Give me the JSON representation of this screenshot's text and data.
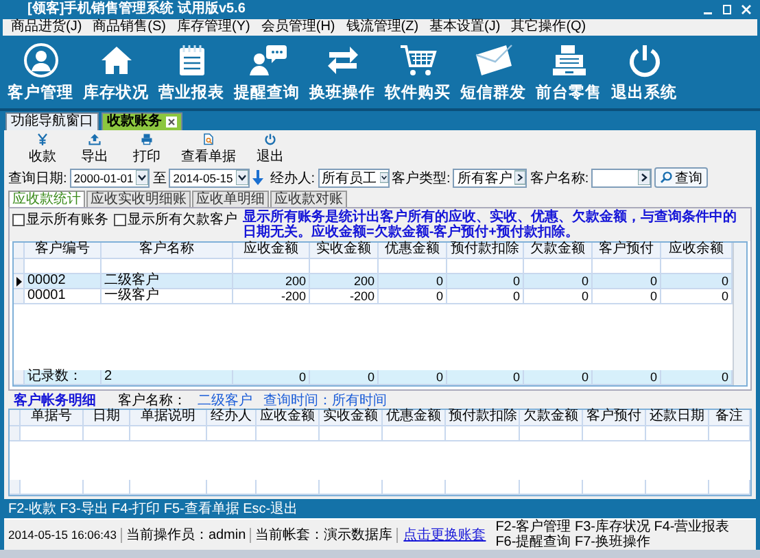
{
  "window": {
    "title": "[领客]手机销售管理系统 试用版v5.6"
  },
  "menu": [
    "商品进货(J)",
    "商品销售(S)",
    "库存管理(Y)",
    "会员管理(H)",
    "钱流管理(Z)",
    "基本设置(J)",
    "其它操作(Q)"
  ],
  "nav": [
    {
      "kind": "customer",
      "label": "客户管理"
    },
    {
      "kind": "house",
      "label": "库存状况"
    },
    {
      "kind": "report",
      "label": "营业报表"
    },
    {
      "kind": "chat",
      "label": "提醒查询"
    },
    {
      "kind": "swap",
      "label": "换班操作"
    },
    {
      "kind": "cart",
      "label": "软件购买"
    },
    {
      "kind": "mail",
      "label": "短信群发"
    },
    {
      "kind": "register",
      "label": "前台零售"
    },
    {
      "kind": "power",
      "label": "退出系统"
    }
  ],
  "tabs": [
    {
      "label": "功能导航窗口",
      "selected": false,
      "closable": false
    },
    {
      "label": "收款账务",
      "selected": true,
      "closable": true
    }
  ],
  "toolbar": [
    {
      "kind": "yen",
      "label": "收款"
    },
    {
      "kind": "export",
      "label": "导出"
    },
    {
      "kind": "print",
      "label": "打印"
    },
    {
      "kind": "doc",
      "label": "查看单据"
    },
    {
      "kind": "power",
      "label": "退出"
    }
  ],
  "query": {
    "date_label": "查询日期:",
    "date_from": "2000-01-01",
    "to_label": "至",
    "date_to": "2014-05-15",
    "handler_label": "经办人:",
    "handler": "所有员工",
    "type_label": "客户类型:",
    "type": "所有客户",
    "name_label": "客户名称:",
    "button": "查询"
  },
  "subtabs": [
    {
      "label": "应收款统计",
      "selected": true
    },
    {
      "label": "应收实收明细账",
      "selected": false
    },
    {
      "label": "应收单明细",
      "selected": false
    },
    {
      "label": "应收款对账",
      "selected": false
    }
  ],
  "checkboxes": [
    {
      "label": "显示所有账务",
      "checked": false
    },
    {
      "label": "显示所有欠款客户",
      "checked": false
    }
  ],
  "notice": "显示所有账务是统计出客户所有的应收、实收、优惠、欠款金额，与查询条件中的日期无关。应收金额=欠款金额-客户预付+预付款扣除。",
  "summary_table": {
    "columns": [
      "客户编号",
      "客户名称",
      "应收金额",
      "实收金额",
      "优惠金额",
      "预付款扣除",
      "欠款金额",
      "客户预付",
      "应收余额"
    ],
    "rows": [
      {
        "selected": true,
        "cells": [
          "00002",
          "二级客户",
          "200",
          "200",
          "0",
          "0",
          "0",
          "0",
          "0"
        ]
      },
      {
        "selected": false,
        "cells": [
          "00001",
          "一级客户",
          "-200",
          "-200",
          "0",
          "0",
          "0",
          "0",
          "0"
        ]
      }
    ],
    "footer": [
      "记录数：",
      "2",
      "0",
      "0",
      "0",
      "0",
      "0",
      "0",
      "0"
    ]
  },
  "detail": {
    "title": "客户帐务明细",
    "name_label": "客户名称：",
    "name": "二级客户",
    "time": "查询时间：所有时间"
  },
  "detail_table": {
    "columns": [
      "单据号",
      "日期",
      "单据说明",
      "经办人",
      "应收金额",
      "实收金额",
      "优惠金额",
      "预付款扣除",
      "欠款金额",
      "客户预付",
      "还款日期",
      "备注"
    ]
  },
  "shortcuts": "F2-收款 F3-导出 F4-打印 F5-查看单据 Esc-退出",
  "status_bar": {
    "time": "2014-05-15 16:06:43",
    "operator": "当前操作员：admin",
    "account": "当前帐套：演示数据库",
    "link": "点击更换账套",
    "keys": "F2-客户管理 F3-库存状况 F4-营业报表 F6-提醒查询 F7-换班操作"
  }
}
